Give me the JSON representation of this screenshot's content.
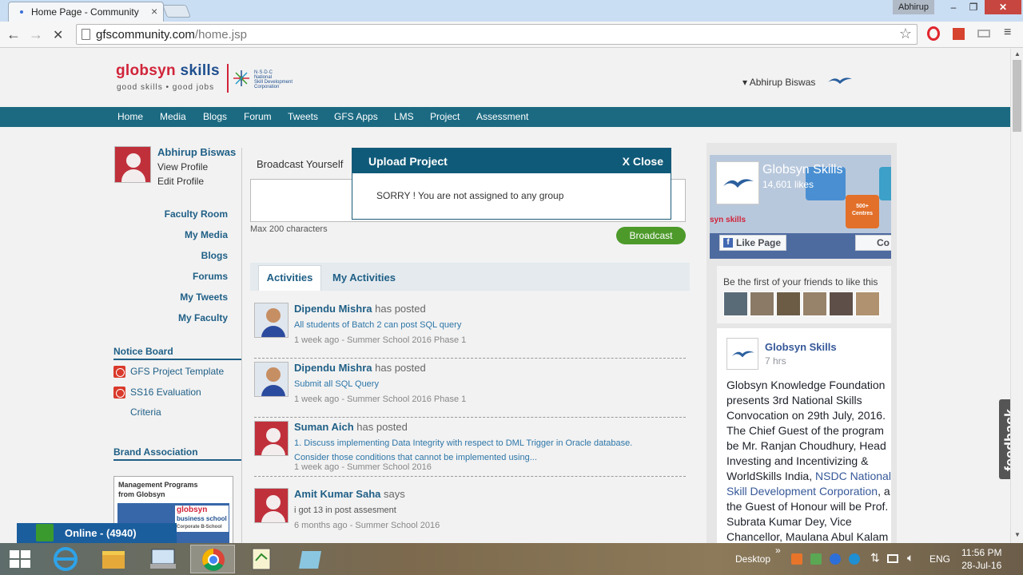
{
  "browser": {
    "tab_title": "Home Page - Community",
    "tab_close": "×",
    "profile_name": "Abhirup",
    "minimize": "–",
    "maximize": "❐",
    "close": "✕",
    "back": "←",
    "forward": "→",
    "reload": "✕",
    "url_host": "gfscommunity.com",
    "url_path": "/home.jsp",
    "bookmark": "☆",
    "menu": "≡"
  },
  "header": {
    "logo_word1": "globsyn",
    "logo_word2": " skills",
    "tagline": "good skills • good jobs",
    "nsdc_line1": "N·S·D·C",
    "nsdc_line2": "National",
    "nsdc_line3": "Skill Development",
    "nsdc_line4": "Corporation",
    "user_name": "▾ Abhirup Biswas"
  },
  "nav": [
    "Home",
    "Media",
    "Blogs",
    "Forum",
    "Tweets",
    "GFS Apps",
    "LMS",
    "Project",
    "Assessment"
  ],
  "profile": {
    "name": "Abhirup Biswas",
    "view_profile": "View Profile",
    "edit_profile": "Edit Profile"
  },
  "left_links": [
    "Faculty Room",
    "My Media",
    "Blogs",
    "Forums",
    "My Tweets",
    "My Faculty"
  ],
  "notice_board": {
    "title": "Notice Board",
    "items": [
      "GFS Project Template",
      "SS16 Evaluation",
      "Criteria"
    ]
  },
  "brand_association": {
    "title": "Brand Association",
    "ad_line1": "Management Programs",
    "ad_line2": "from Globsyn",
    "ad_brand": "globsyn",
    "ad_brand2": "business school",
    "ad_brand3": "Corporate B-School"
  },
  "broadcast": {
    "label": "Broadcast Yourself",
    "max_chars": "Max 200 characters",
    "button": "Broadcast"
  },
  "activity_tabs": [
    "Activities",
    "My Activities"
  ],
  "posts": [
    {
      "author": "Dipendu Mishra",
      "verb": " has posted",
      "message": "All students of Batch 2 can post SQL query",
      "meta": "1 week ago - Summer School 2016 Phase 1"
    },
    {
      "author": "Dipendu Mishra",
      "verb": " has posted",
      "message": "Submit all SQL Query",
      "meta": "1 week ago - Summer School 2016 Phase 1"
    },
    {
      "author": "Suman Aich",
      "verb": " has posted",
      "message": "1. Discuss implementing Data Integrity with respect to DML Trigger in Oracle database. Consider those conditions that cannot be implemented using...",
      "meta": "1 week ago - Summer School 2016"
    },
    {
      "author": "Amit Kumar Saha",
      "verb": " says",
      "message": "i got 13 in post assesment",
      "meta": "6 months ago - Summer School 2016"
    }
  ],
  "modal": {
    "title": "Upload Project",
    "close": "X Close",
    "message": "SORRY ! You are not assigned to any group"
  },
  "facebook": {
    "page_name": "Globsyn Skills",
    "likes": "14,601 likes",
    "brand_small": "syn skills",
    "tile_text": "500+ Centres",
    "like_button": "Like Page",
    "contact_button": "Co",
    "friends_text": "Be the first of your friends to like this",
    "post_name": "Globsyn Skills",
    "post_time": "7 hrs",
    "post_text_1": "Globsyn Knowledge Foundation presents 3rd National Skills Convocation on 29th July, 2016. The Chief Guest of the program be Mr. Ranjan Choudhury, Head Investing and Incentivizing & WorldSkills India, ",
    "post_link": "NSDC National Skill Development Corporation",
    "post_text_2": ", a the Guest of Honour will be Prof. Subrata Kumar Dey, Vice Chancellor, Maulana Abul Kalam"
  },
  "feedback": "feedback",
  "online": "Online - (4940)",
  "taskbar": {
    "desktop": "Desktop",
    "chevron": "»",
    "lang": "ENG",
    "time": "11:56 PM",
    "date": "28-Jul-16"
  },
  "colors": {
    "nav_bar": "#1b6a82",
    "link_blue": "#1f5f86",
    "brand_red": "#d1243a",
    "broadcast_green": "#4d9a2a",
    "modal_header": "#0f5a78"
  }
}
